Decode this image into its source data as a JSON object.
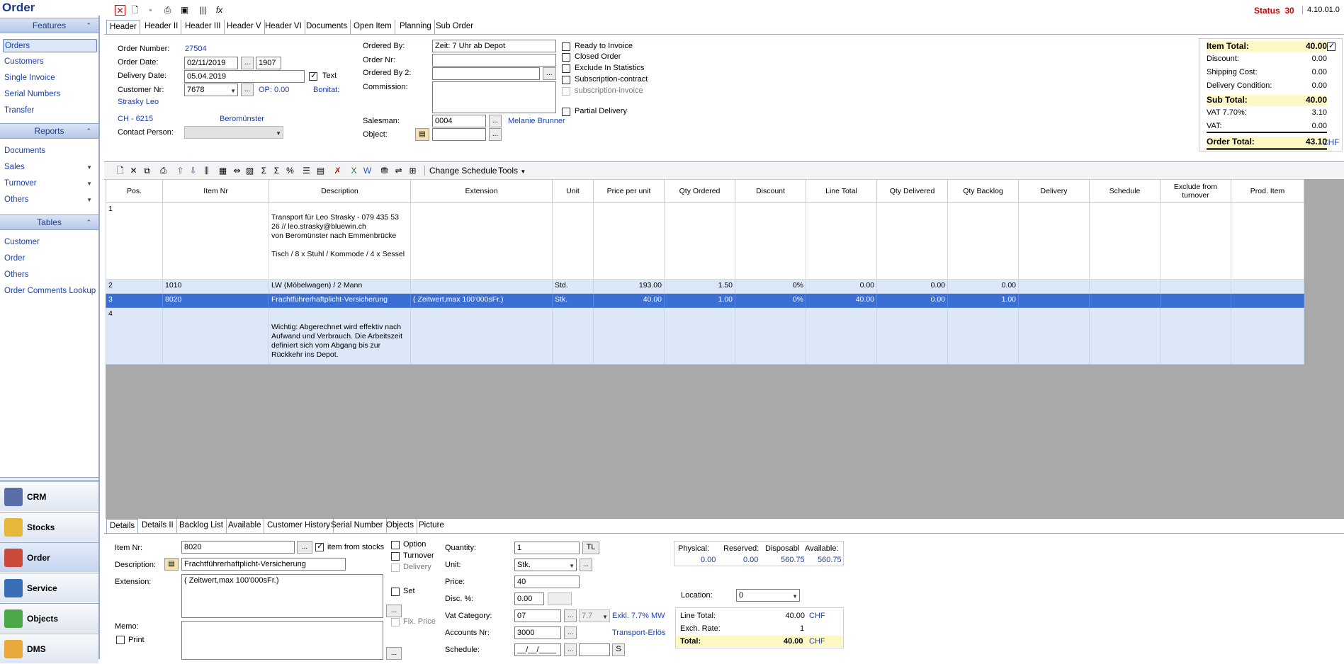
{
  "app": {
    "title": "Order",
    "status_label": "Status",
    "status_value": "30",
    "version": "4.10.01.0"
  },
  "sidebar": {
    "features_title": "Features",
    "features": [
      {
        "label": "Orders",
        "selected": true
      },
      {
        "label": "Customers"
      },
      {
        "label": "Single Invoice"
      },
      {
        "label": "Serial Numbers"
      },
      {
        "label": "Transfer"
      }
    ],
    "reports_title": "Reports",
    "reports": [
      {
        "label": "Documents"
      },
      {
        "label": "Sales"
      },
      {
        "label": "Turnover"
      },
      {
        "label": "Others"
      }
    ],
    "tables_title": "Tables",
    "tables": [
      {
        "label": "Customer"
      },
      {
        "label": "Order"
      },
      {
        "label": "Others"
      },
      {
        "label": "Order Comments Lookup"
      }
    ],
    "nav": [
      {
        "label": "CRM"
      },
      {
        "label": "Stocks"
      },
      {
        "label": "Order"
      },
      {
        "label": "Service"
      },
      {
        "label": "Objects"
      },
      {
        "label": "DMS"
      }
    ]
  },
  "header_tabs": [
    "Header",
    "Header II",
    "Header III",
    "Header V",
    "Header VI",
    "Documents",
    "Open Item",
    "Planning",
    "Sub Order"
  ],
  "header": {
    "order_number_label": "Order Number:",
    "order_number": "27504",
    "order_date_label": "Order Date:",
    "order_date": "02/11/2019",
    "order_date_ext": "1907",
    "delivery_date_label": "Delivery Date:",
    "delivery_date": "05.04.2019",
    "text_label": "Text",
    "customer_nr_label": "Customer Nr:",
    "customer_nr": "7678",
    "op_label": "OP: 0.00",
    "bonitat_label": "Bonitat:",
    "customer_name": "Strasky Leo",
    "country_zip": "CH -  6215",
    "city": "Beromünster",
    "contact_person_label": "Contact Person:",
    "ordered_by_label": "Ordered By:",
    "ordered_by": "Zeit: 7 Uhr ab Depot",
    "order_nr_label": "Order Nr:",
    "ordered_by2_label": "Ordered By 2:",
    "commission_label": "Commission:",
    "salesman_label": "Salesman:",
    "salesman_nr": "0004",
    "salesman_name": "Melanie Brunner",
    "object_label": "Object:",
    "checks": [
      {
        "label": "Ready to Invoice"
      },
      {
        "label": "Closed Order"
      },
      {
        "label": "Exclude In Statistics"
      },
      {
        "label": "Subscription-contract"
      },
      {
        "label": "subscription-invoice"
      }
    ],
    "partial_delivery_label": "Partial Delivery"
  },
  "totals": {
    "item_total_label": "Item Total:",
    "item_total": "40.00",
    "discount_label": "Discount:",
    "discount": "0.00",
    "shipping_label": "Shipping Cost:",
    "shipping": "0.00",
    "delivery_cond_label": "Delivery Condition:",
    "delivery_cond": "0.00",
    "sub_total_label": "Sub Total:",
    "sub_total": "40.00",
    "vat1_label": "VAT 7.70%:",
    "vat1": "3.10",
    "vat2_label": "VAT:",
    "vat2": "0.00",
    "order_total_label": "Order Total:",
    "order_total": "43.10",
    "currency": "CHF"
  },
  "toolbar2": {
    "change_schedule": "Change Schedule",
    "tools": "Tools"
  },
  "grid": {
    "columns": [
      "Pos.",
      "Item Nr",
      "Description",
      "Extension",
      "Unit",
      "Price per unit",
      "Qty Ordered",
      "Discount",
      "Line Total",
      "Qty Delivered",
      "Qty Backlog",
      "Delivery",
      "Schedule",
      "Exclude from turnover",
      "Prod. Item"
    ],
    "rows": [
      {
        "pos": "1",
        "item": "",
        "desc": "Transport für Leo Strasky - 079 435 53 26 // leo.strasky@bluewin.ch\nvon Beromünster nach Emmenbrücke\n\nTisch / 8 x Stuhl / Kommode / 4 x Sessel",
        "ext": "",
        "unit": "",
        "price": "",
        "qty": "",
        "disc": "",
        "line": "",
        "deliv": "",
        "backlog": ""
      },
      {
        "pos": "2",
        "item": "1010",
        "desc": "LW (Möbelwagen) / 2 Mann",
        "ext": "",
        "unit": "Std.",
        "price": "193.00",
        "qty": "1.50",
        "disc": "0%",
        "line": "0.00",
        "deliv": "0.00",
        "backlog": "0.00"
      },
      {
        "pos": "3",
        "item": "8020",
        "desc": "Frachtführerhaftplicht-Versicherung",
        "ext": "( Zeitwert,max 100'000sFr.)",
        "unit": "Stk.",
        "price": "40.00",
        "qty": "1.00",
        "disc": "0%",
        "line": "40.00",
        "deliv": "0.00",
        "backlog": "1.00"
      },
      {
        "pos": "4",
        "item": "",
        "desc": "\nWichtig: Abgerechnet wird effektiv nach Aufwand und Verbrauch. Die Arbeitszeit definiert sich vom Abgang bis zur Rückkehr ins Depot.",
        "ext": "",
        "unit": "",
        "price": "",
        "qty": "",
        "disc": "",
        "line": "",
        "deliv": "",
        "backlog": ""
      }
    ]
  },
  "detail_tabs": [
    "Details",
    "Details II",
    "Backlog List",
    "Available",
    "Customer History",
    "Serial Number",
    "Objects",
    "Picture"
  ],
  "detail": {
    "item_nr_label": "Item Nr:",
    "item_nr": "8020",
    "item_from_stocks": "item from stocks",
    "description_label": "Description:",
    "description": "Frachtführerhaftplicht-Versicherung",
    "extension_label": "Extension:",
    "extension": "( Zeitwert,max 100'000sFr.)",
    "memo_label": "Memo:",
    "print_label": "Print",
    "option_label": "Option",
    "turnover_label": "Turnover",
    "delivery_label": "Delivery",
    "set_label": "Set",
    "fix_price_label": "Fix. Price",
    "quantity_label": "Quantity:",
    "quantity": "1",
    "tl_btn": "TL",
    "unit_label": "Unit:",
    "unit": "Stk.",
    "price_label": "Price:",
    "price": "40",
    "disc_label": "Disc. %:",
    "disc": "0.00",
    "vat_cat_label": "Vat Category:",
    "vat_cat": "07",
    "vat_rate": "7.7",
    "vat_desc": "Exkl. 7.7% MW",
    "accounts_label": "Accounts Nr:",
    "accounts": "3000",
    "accounts_desc": "Transport-Erlös",
    "schedule_label": "Schedule:",
    "schedule": "__/__/____",
    "s_btn": "S",
    "physical_label": "Physical:",
    "reserved_label": "Reserved:",
    "disposabl_label": "Disposabl",
    "available_label": "Available:",
    "physical": "0.00",
    "reserved": "0.00",
    "disposabl": "560.75",
    "available": "560.75",
    "location_label": "Location:",
    "location": "0",
    "line_total_label": "Line Total:",
    "line_total": "40.00",
    "exch_label": "Exch. Rate:",
    "exch": "1",
    "total_label": "Total:",
    "total": "40.00",
    "currency": "CHF"
  },
  "colors": {
    "accent": "#1a3fb0",
    "selected_row": "#3b6fd4",
    "row_bg": "#dce8f7",
    "status": "#cc0000",
    "highlight": "#fff8c5"
  }
}
